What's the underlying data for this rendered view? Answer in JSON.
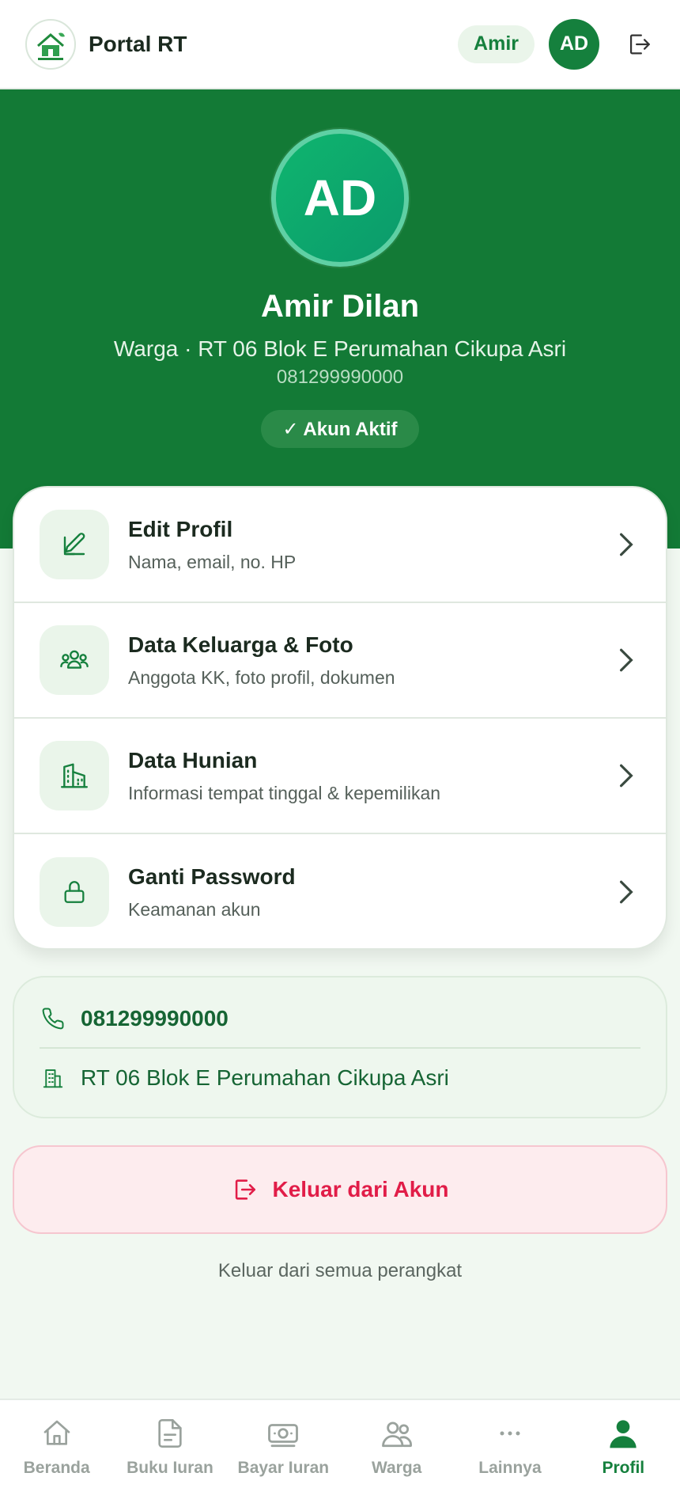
{
  "header": {
    "app_title": "Portal RT",
    "user_chip": "Amir",
    "avatar_initials": "AD",
    "logout_icon": "logout-icon"
  },
  "profile": {
    "initials": "AD",
    "name": "Amir Dilan",
    "subtitle": "Warga · RT 06 Blok E Perumahan Cikupa Asri",
    "phone": "081299990000",
    "status": "✓ Akun Aktif"
  },
  "menu": [
    {
      "title": "Edit Profil",
      "desc": "Nama, email, no. HP",
      "icon": "edit-icon"
    },
    {
      "title": "Data Keluarga & Foto",
      "desc": "Anggota KK, foto profil, dokumen",
      "icon": "family-icon"
    },
    {
      "title": "Data Hunian",
      "desc": "Informasi tempat tinggal & kepemilikan",
      "icon": "building-icon"
    },
    {
      "title": "Ganti Password",
      "desc": "Keamanan akun",
      "icon": "lock-icon"
    }
  ],
  "contact": {
    "phone": "081299990000",
    "address": "RT 06 Blok E Perumahan Cikupa Asri"
  },
  "actions": {
    "logout": "Keluar dari Akun",
    "logout_all": "Keluar dari semua perangkat"
  },
  "nav": [
    {
      "label": "Beranda",
      "icon": "home-icon"
    },
    {
      "label": "Buku Iuran",
      "icon": "document-icon"
    },
    {
      "label": "Bayar Iuran",
      "icon": "money-icon"
    },
    {
      "label": "Warga",
      "icon": "people-icon"
    },
    {
      "label": "Lainnya",
      "icon": "more-icon"
    },
    {
      "label": "Profil",
      "icon": "user-icon",
      "active": true
    }
  ],
  "colors": {
    "primary": "#15803d",
    "hero": "#137a36",
    "danger": "#e11d48",
    "background": "#f1f8f1"
  }
}
